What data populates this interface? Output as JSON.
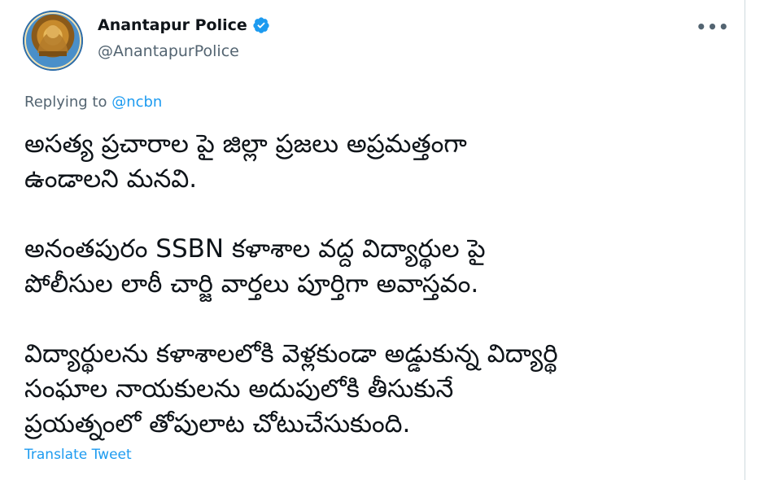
{
  "account": {
    "display_name": "Anantapur Police",
    "handle": "@AnantapurPolice",
    "verified_icon": "verified-badge-icon",
    "avatar_icon": "police-seal-avatar"
  },
  "more_options": {
    "icon": "more-options-icon",
    "label": "•••"
  },
  "reply_context": {
    "prefix": "Replying to ",
    "mention": "@ncbn"
  },
  "tweet": {
    "paragraphs": [
      "అసత్య ప్రచారాల పై జిల్లా  ప్రజలు అప్రమత్తంగా\nఉండాలని మనవి.",
      "అనంతపురం SSBN కళాశాల వద్ద విద్యార్థుల పై\nపోలీసుల లాఠీ చార్జి  వార్తలు పూర్తిగా అవాస్తవం.",
      "విద్యార్థులను కళాశాలలోకి వెళ్లకుండా అడ్డుకున్న విద్యార్థి\nసంఘాల నాయకులను అదుపులోకి తీసుకునే\nప్రయత్నంలో తోపులాట చోటుచేసుకుంది."
    ]
  },
  "translate_label": "Translate Tweet",
  "colors": {
    "link": "#1d9bf0",
    "secondary_text": "#536471",
    "primary_text": "#0f1419"
  }
}
